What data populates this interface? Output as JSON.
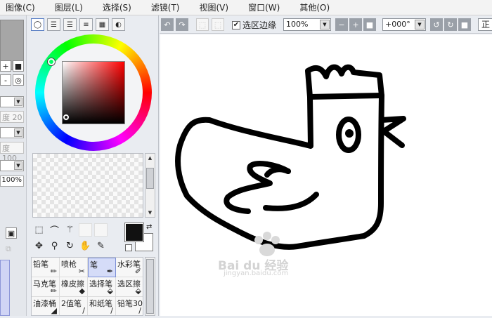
{
  "menu": [
    "图像(C)",
    "图层(L)",
    "选择(S)",
    "滤镜(T)",
    "视图(V)",
    "窗口(W)",
    "其他(O)"
  ],
  "left_strip": {
    "field_1": "度 20",
    "field_2": "度 100",
    "percent": "100%"
  },
  "color_tabs": [
    "wheel",
    "rgb-sliders",
    "hsv-sliders",
    "palette",
    "swatches",
    "scratchpad"
  ],
  "colors": {
    "foreground": "#111111",
    "background": "#ffffff",
    "selected_brush": "#d5dcf8"
  },
  "brushes": [
    {
      "name": "铅笔",
      "icon": "pencil-icon"
    },
    {
      "name": "喷枪",
      "icon": "airbrush-icon"
    },
    {
      "name": "笔",
      "icon": "pen-icon"
    },
    {
      "name": "水彩笔",
      "icon": "watercolor-icon"
    },
    {
      "name": "马克笔",
      "icon": "marker-icon"
    },
    {
      "name": "橡皮擦",
      "icon": "eraser-icon"
    },
    {
      "name": "选择笔",
      "icon": "select-pen-icon"
    },
    {
      "name": "选区擦",
      "icon": "select-eraser-icon"
    },
    {
      "name": "油漆桶",
      "icon": "bucket-icon"
    },
    {
      "name": "2值笔",
      "icon": "binary-pen-icon"
    },
    {
      "name": "和纸笔",
      "icon": "washi-pen-icon"
    },
    {
      "name": "铅笔30",
      "icon": "pencil30-icon"
    }
  ],
  "selected_brush": "笔",
  "canvas_toolbar": {
    "selection_edge_label": "选区边缘",
    "selection_edge_checked": "✔",
    "zoom": "100%",
    "rotation": "+000°",
    "flip_label": "正"
  },
  "watermark": {
    "brand": "Bai du 经验",
    "url": "jingyan.baidu.com"
  }
}
